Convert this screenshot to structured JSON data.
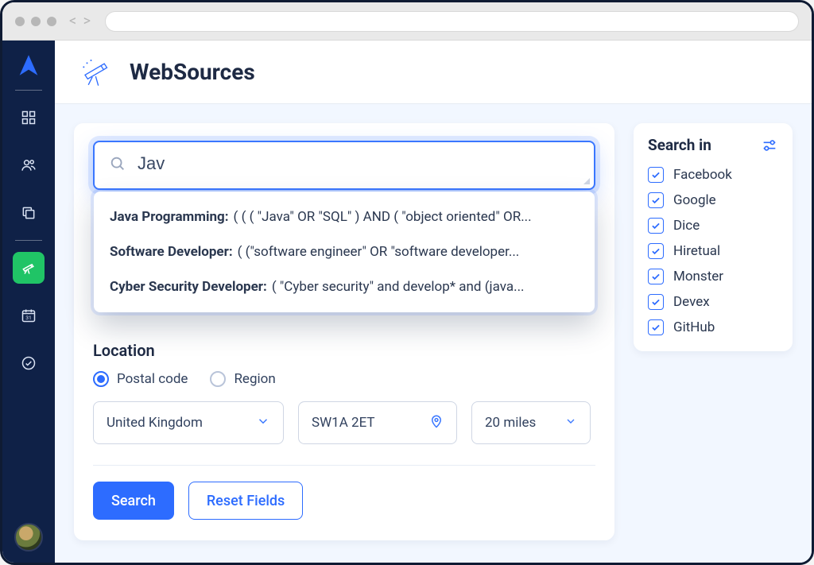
{
  "page": {
    "title": "WebSources"
  },
  "search": {
    "value": "Jav",
    "suggestions": [
      {
        "title": "Java Programming:",
        "query": "( ( ( \"Java\" OR \"SQL\" ) AND ( \"object oriented\" OR..."
      },
      {
        "title": "Software Developer:",
        "query": "( (\"software engineer\" OR \"software developer..."
      },
      {
        "title": "Cyber Security Developer:",
        "query": "( \"Cyber security\" and develop* and (java..."
      }
    ]
  },
  "location": {
    "label": "Location",
    "mode_options": {
      "postal": "Postal code",
      "region": "Region"
    },
    "mode_selected": "postal",
    "country": "United Kingdom",
    "postal_code": "SW1A 2ET",
    "radius": "20 miles"
  },
  "buttons": {
    "search": "Search",
    "reset": "Reset Fields"
  },
  "filters": {
    "title": "Search in",
    "sources": [
      {
        "label": "Facebook",
        "checked": true
      },
      {
        "label": "Google",
        "checked": true
      },
      {
        "label": "Dice",
        "checked": true
      },
      {
        "label": "Hiretual",
        "checked": true
      },
      {
        "label": "Monster",
        "checked": true
      },
      {
        "label": "Devex",
        "checked": true
      },
      {
        "label": "GitHub",
        "checked": true
      }
    ]
  }
}
